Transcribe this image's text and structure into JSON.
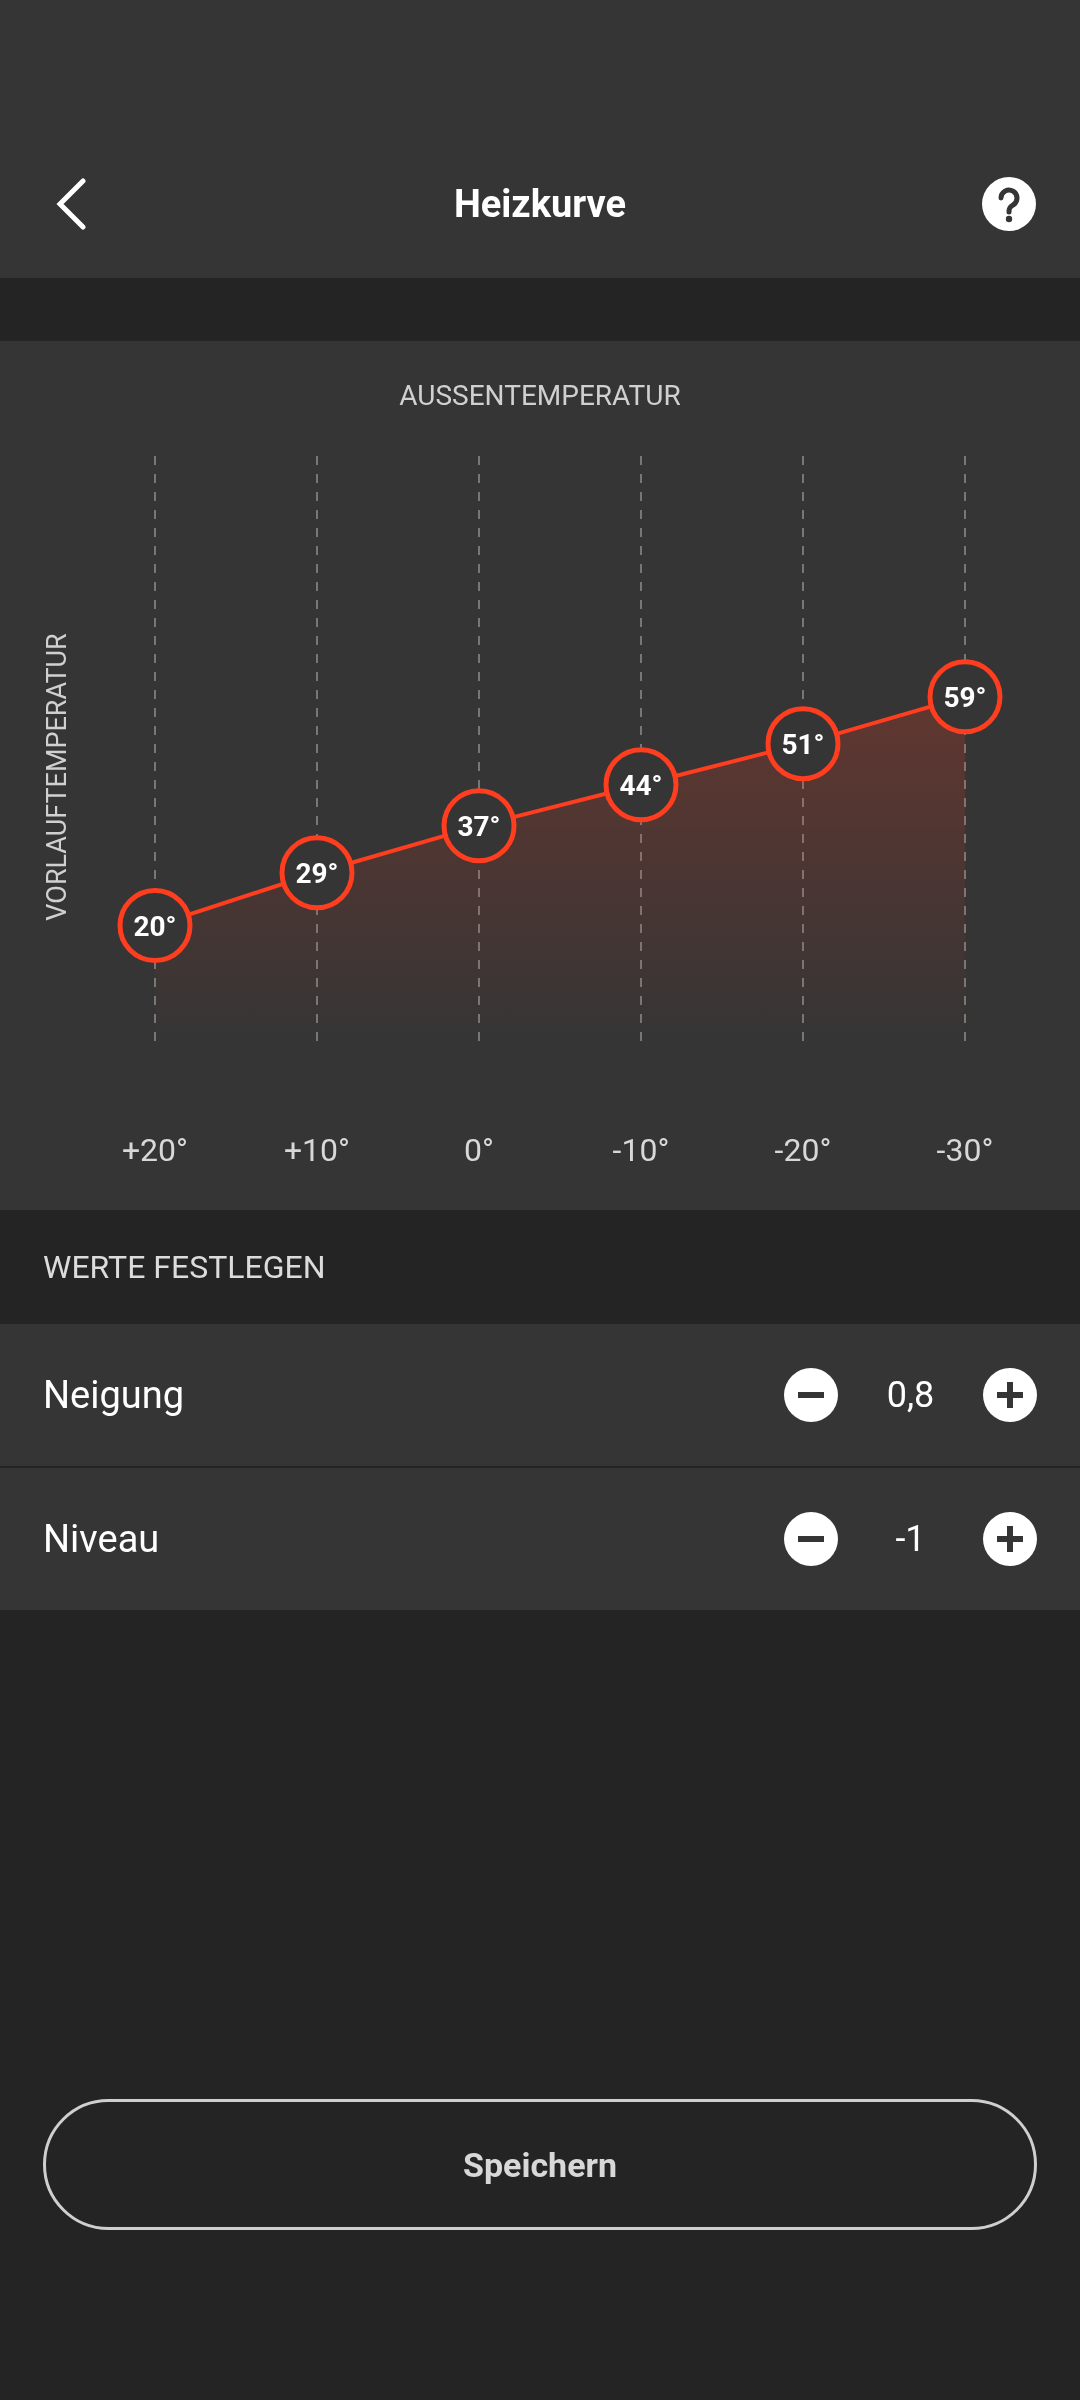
{
  "header": {
    "title": "Heizkurve"
  },
  "chart": {
    "chart_data": {
      "type": "area",
      "xlabel": "AUSSENTEMPERATUR",
      "ylabel": "VORLAUFTEMPERATUR",
      "categories": [
        "+20°",
        "+10°",
        "0°",
        "-10°",
        "-20°",
        "-30°"
      ],
      "grid": true,
      "data_labels": true,
      "series": [
        {
          "color": "#ff3d1f",
          "values": [
            20,
            29,
            37,
            44,
            51,
            59
          ],
          "value_labels": [
            "20°",
            "29°",
            "37°",
            "44°",
            "51°",
            "59°"
          ]
        }
      ]
    }
  },
  "section_title": "WERTE FESTLEGEN",
  "settings": [
    {
      "label": "Neigung",
      "value": "0,8"
    },
    {
      "label": "Niveau",
      "value": "-1"
    }
  ],
  "save_button": "Speichern"
}
